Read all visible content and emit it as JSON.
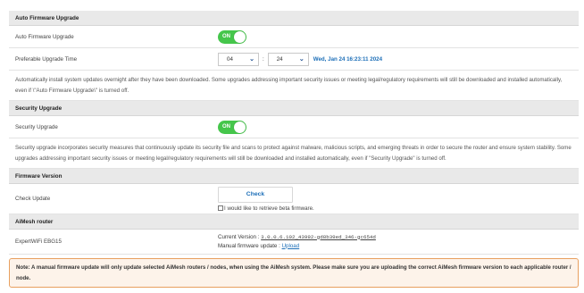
{
  "auto_fw": {
    "section_title": "Auto Firmware Upgrade",
    "toggle_label": "Auto Firmware Upgrade",
    "toggle_state": "ON",
    "time_label": "Preferable Upgrade Time",
    "hour": "04",
    "minute": "24",
    "current_time": "Wed, Jan 24 16:23:11 2024",
    "description": "Automatically install system updates overnight after they have been downloaded. Some upgrades addressing important security issues or meeting legal/regulatory requirements will still be downloaded and installed automatically, even if \\\"Auto Firmware Upgrade\\\" is turned off."
  },
  "security": {
    "section_title": "Security Upgrade",
    "toggle_label": "Security Upgrade",
    "toggle_state": "ON",
    "description": "Security upgrade incorporates security measures that continuously update its security file and scans to protect against malware, malicious scripts, and emerging threats in order to secure the router and ensure system stability. Some upgrades addressing important security issues or meeting legal/regulatory requirements will still be downloaded and installed automatically, even if \"Security Upgrade\" is turned off."
  },
  "firmware": {
    "section_title": "Firmware Version",
    "check_label": "Check Update",
    "check_button": "Check",
    "beta_label": "I would like to retrieve beta firmware."
  },
  "aimesh": {
    "section_title": "AiMesh router",
    "device_name": "ExpertWiFi EBG15",
    "current_version_label": "Current Version :",
    "current_version": "3.0.0.6.102_43992-gd8b39ed_346-gc654d",
    "manual_label": "Manual firmware update :",
    "upload_link": "Upload"
  },
  "note": "Note: A manual firmware update will only update selected AiMesh routers / nodes, when using the AiMesh system. Please make sure you are uploading the correct AiMesh firmware version to each applicable router / node.",
  "colors": {
    "toggle_on": "#45c64b",
    "accent": "#1d6fb8",
    "note_border": "#e8a05f"
  }
}
